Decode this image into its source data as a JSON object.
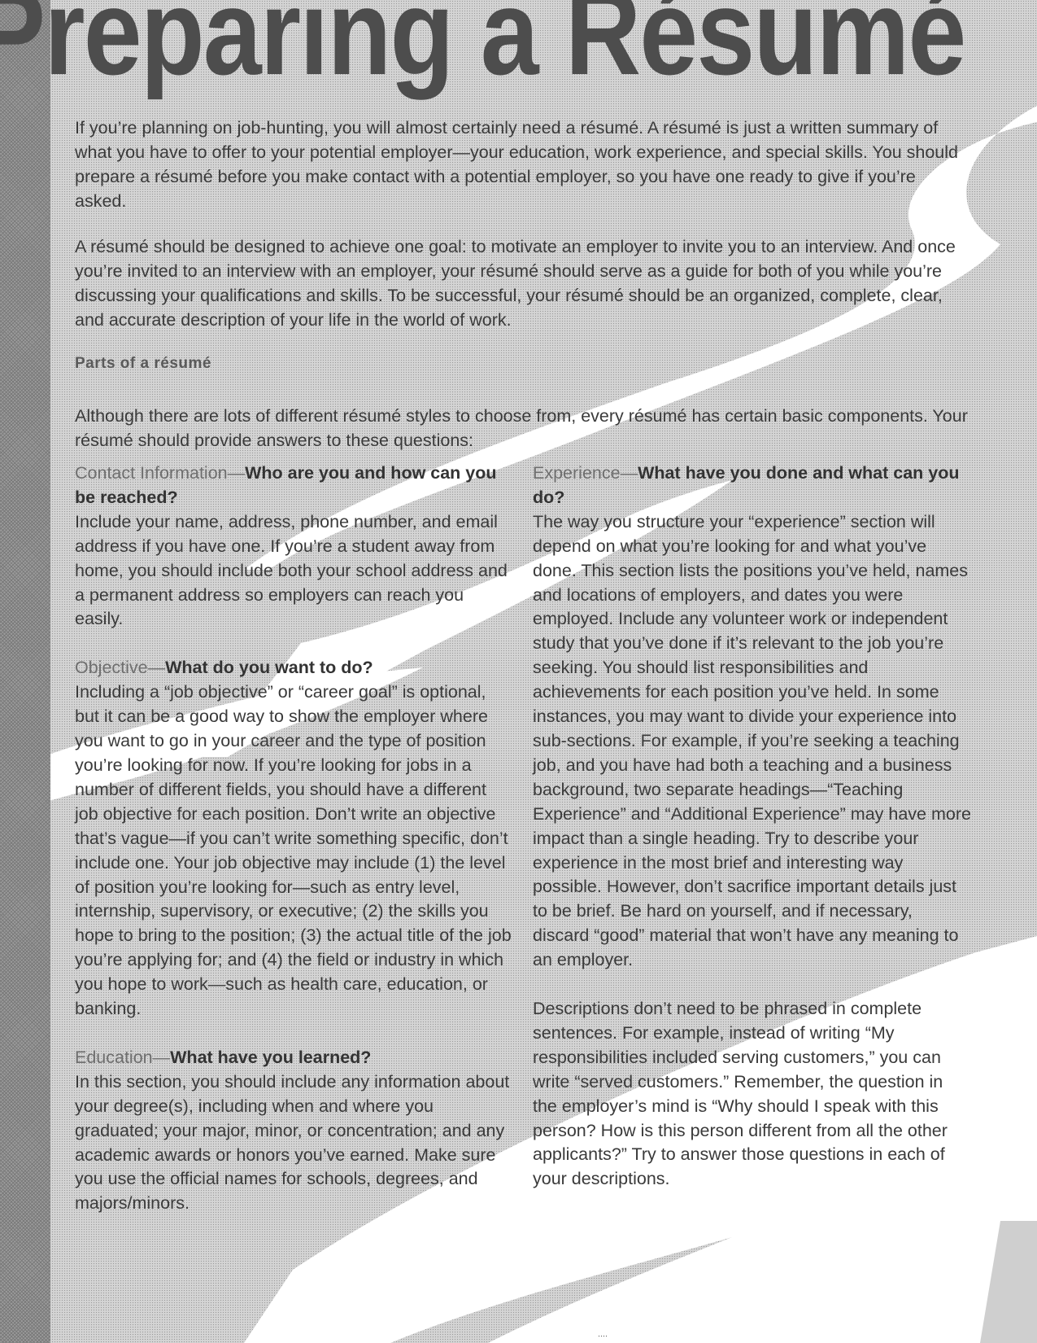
{
  "title": "Preparing a Résumé",
  "intro": [
    "If you’re planning on job-hunting, you will almost certainly need a résumé.  A résumé is just a written summary of what you have to offer to your potential employer—your education, work experience, and special skills.  You should prepare a résumé before you make contact with a potential employer, so you have one ready to give if you’re asked.",
    "A résumé should be designed to achieve one goal: to motivate an employer to invite you to an interview. And once you’re invited to an interview with an employer, your résumé should serve as a guide for both of you while you’re discussing your qualifications and skills.  To be successful, your résumé should be an organized, complete, clear, and accurate description of your life in the world of work."
  ],
  "parts_heading": "Parts of a résumé",
  "parts_intro": "Although there are lots of different résumé styles to choose from, every résumé has certain basic components.  Your résumé should provide answers to these questions:",
  "sections_left": [
    {
      "label": "Contact Information—",
      "question": "Who are you and how can you be reached?",
      "body": "Include your name, address, phone number, and email address if you have one.   If you’re a student away from home, you should include both your school address and a permanent address so employers can reach you easily."
    },
    {
      "label": "Objective—",
      "question": "What do you want to do?",
      "body": "Including a “job objective” or “career goal” is optional, but it can be a good way to show the employer where you want to go in your career and the type of position you’re looking for now.  If you’re looking for jobs in a number of different fields, you should have a different job objective for each position. Don’t write an objective that’s vague—if you can’t write something specific, don’t include one.  Your job objective may include (1) the level of position you’re looking for—such as entry level, internship, supervisory, or executive; (2) the skills you hope to bring to the position; (3) the actual title of the job you’re applying for; and (4) the field or industry in which you hope to work—such as health care, education, or banking."
    },
    {
      "label": "Education—",
      "question": "What have you learned?",
      "body": "In this section, you should include any information about your degree(s), including when and where you graduated; your major, minor, or concentration; and any academic awards or honors you’ve earned.  Make sure you use the official names for schools, degrees, and majors/minors."
    }
  ],
  "sections_right": [
    {
      "label": "Experience—",
      "question": "What have you done and what can you do?",
      "body": "The way you structure your “experience” section will depend on what you’re looking for and what you’ve done.  This section lists the positions you’ve held, names and locations of employers, and dates you were employed. Include any volunteer work or independent study that you’ve done if it’s relevant to the job you’re seeking. You should list responsibilities and achievements for each position you’ve held.  In some instances, you may want to divide your experience into sub-sections.  For example, if you’re seeking a teaching job, and you have had both a teaching and a business background, two separate headings—“Teaching Experience” and “Additional Experience” may have more impact than a single heading. Try to describe your experience in the most brief and interesting way possible.  However, don’t sacrifice important details just to be brief.  Be hard on yourself, and if necessary, discard “good” material that won’t have any meaning to an employer."
    }
  ],
  "right_closing": "Descriptions don’t need to be phrased in complete sentences.  For example, instead of writing “My responsibilities included serving customers,” you can write “served customers.”  Remember, the question in the employer’s mind is “Why should I speak with this person? How is this person different from all the other applicants?”  Try to answer those questions in each of your descriptions."
}
